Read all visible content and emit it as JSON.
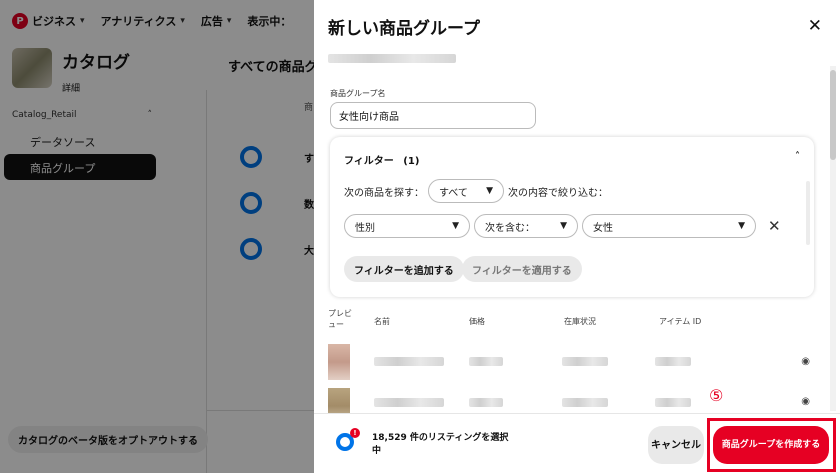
{
  "topnav": {
    "items": [
      {
        "label": "ビジネス"
      },
      {
        "label": "アナリティクス"
      },
      {
        "label": "広告"
      },
      {
        "label": "表示中："
      }
    ]
  },
  "sidebar": {
    "catalog_title": "カタログ",
    "catalog_sub": "詳細",
    "section": "Catalog_Retail",
    "items": [
      {
        "label": "データソース"
      },
      {
        "label": "商品グループ"
      }
    ],
    "optout": "カタログのベータ版をオプトアウトする"
  },
  "main": {
    "title": "すべての商品グル",
    "col": "商",
    "rows": [
      {
        "label": "す"
      },
      {
        "label": "数"
      },
      {
        "label": "大"
      }
    ]
  },
  "panel": {
    "title": "新しい商品グループ",
    "close": "✕",
    "name_label": "商品グループ名",
    "name_value": "女性向け商品",
    "filter": {
      "title": "フィルター",
      "count": "(1)",
      "search_label": "次の商品を探す：",
      "scope": "すべて",
      "narrow_label": "次の内容で絞り込む：",
      "field": "性別",
      "operator": "次を含む：",
      "value": "女性",
      "add_button": "フィルターを追加する",
      "apply_button": "フィルターを適用する"
    },
    "table": {
      "headers": {
        "preview": "プレビュー",
        "name": "名前",
        "price": "価格",
        "stock": "在庫状況",
        "item_id": "アイテム ID"
      }
    },
    "footer": {
      "badge": "!",
      "status": "18,529 件のリスティングを選択中",
      "cancel": "キャンセル",
      "create": "商品グループを作成する"
    },
    "step_marker": "⑤"
  },
  "colors": {
    "brand_red": "#e60023",
    "accent_blue": "#0074e8"
  }
}
